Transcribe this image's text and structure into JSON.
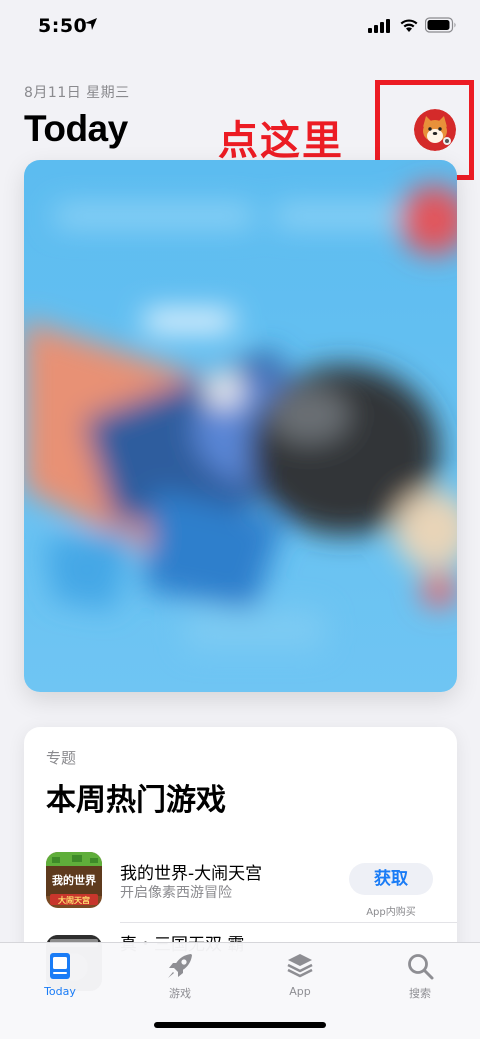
{
  "status_bar": {
    "time": "5:50"
  },
  "header": {
    "date": "8月11日 星期三",
    "title": "Today"
  },
  "annotation": {
    "text": "点这里",
    "color": "#ec1c24"
  },
  "topic_card": {
    "eyebrow": "专题",
    "title": "本周热门游戏",
    "apps": [
      {
        "name": "我的世界-大闹天宫",
        "subtitle": "开启像素西游冒险",
        "button": "获取",
        "note": "App内购买",
        "icon_text": "我的世界",
        "icon_banner": "大闹天宫"
      },
      {
        "name": "真・三国无双 霸"
      }
    ]
  },
  "tab_bar": {
    "tabs": [
      {
        "label": "Today",
        "icon": "today-icon",
        "active": true
      },
      {
        "label": "游戏",
        "icon": "rocket-icon"
      },
      {
        "label": "App",
        "icon": "layers-icon"
      },
      {
        "label": "搜索",
        "icon": "search-icon"
      }
    ]
  },
  "colors": {
    "accent": "#1a7cf6",
    "annotation_red": "#ec1c24",
    "background": "#f2f2f6"
  }
}
